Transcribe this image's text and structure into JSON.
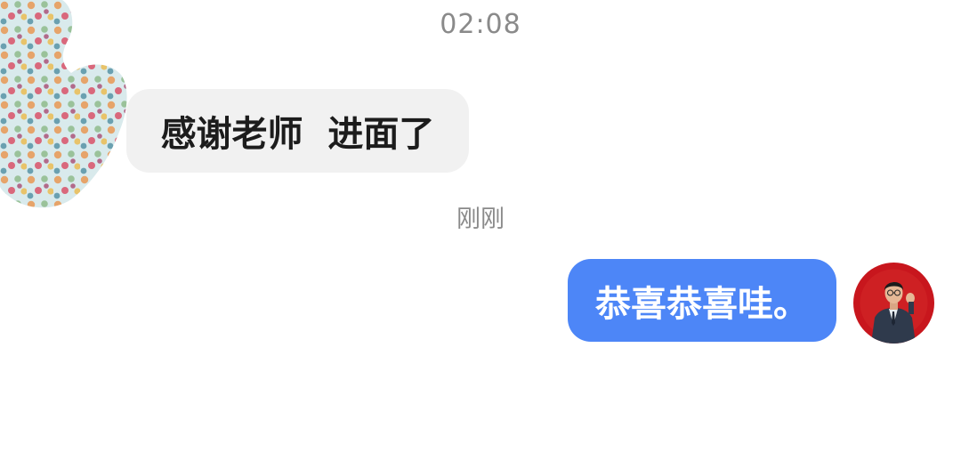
{
  "chat": {
    "timestamps": {
      "first": "02:08",
      "second": "刚刚"
    },
    "messages": [
      {
        "direction": "incoming",
        "text": "感谢老师  进面了",
        "avatar_icon": "polka-dot-cactus-avatar"
      },
      {
        "direction": "outgoing",
        "text": "恭喜恭喜哇。",
        "avatar_icon": "teacher-photo-avatar"
      }
    ]
  },
  "colors": {
    "background": "#ffffff",
    "incoming_bubble": "#f1f1f1",
    "incoming_text": "#1c1c1c",
    "outgoing_bubble": "#4d86f7",
    "outgoing_text": "#ffffff",
    "timestamp_text": "#8a8a8a",
    "avatar_red": "#c8161d"
  }
}
